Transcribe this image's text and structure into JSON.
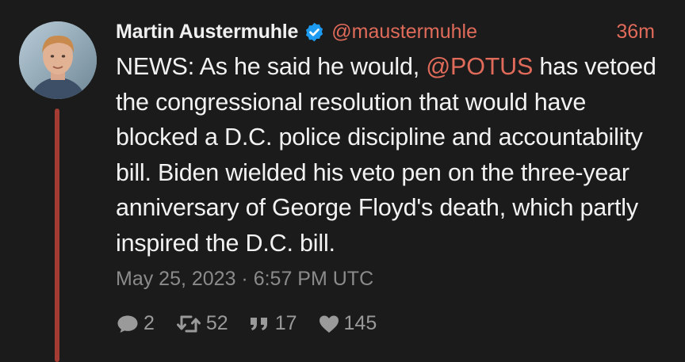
{
  "author": {
    "name": "Martin Austermuhle",
    "handle": "@maustermuhle",
    "relative_time": "36m",
    "verified": true
  },
  "tweet": {
    "text_before_mention": "NEWS: As he said he would, ",
    "mention": "@POTUS",
    "text_after_mention": " has vetoed the congressional resolution that would have blocked a D.C. police discipline and accountability bill. Biden wielded his veto pen on the three-year anniversary of George Floyd's death, which partly inspired the D.C. bill.",
    "timestamp": "May 25, 2023 · 6:57 PM UTC"
  },
  "stats": {
    "replies": "2",
    "retweets": "52",
    "quotes": "17",
    "likes": "145"
  },
  "colors": {
    "background": "#1b1b1b",
    "accent": "#e06b5a",
    "thread_line": "#a53c34",
    "verified_badge": "#1d9bf0"
  },
  "icons": {
    "verified": "verified-badge-icon",
    "reply": "comment-icon",
    "retweet": "retweet-icon",
    "quote": "quote-icon",
    "like": "heart-icon"
  }
}
